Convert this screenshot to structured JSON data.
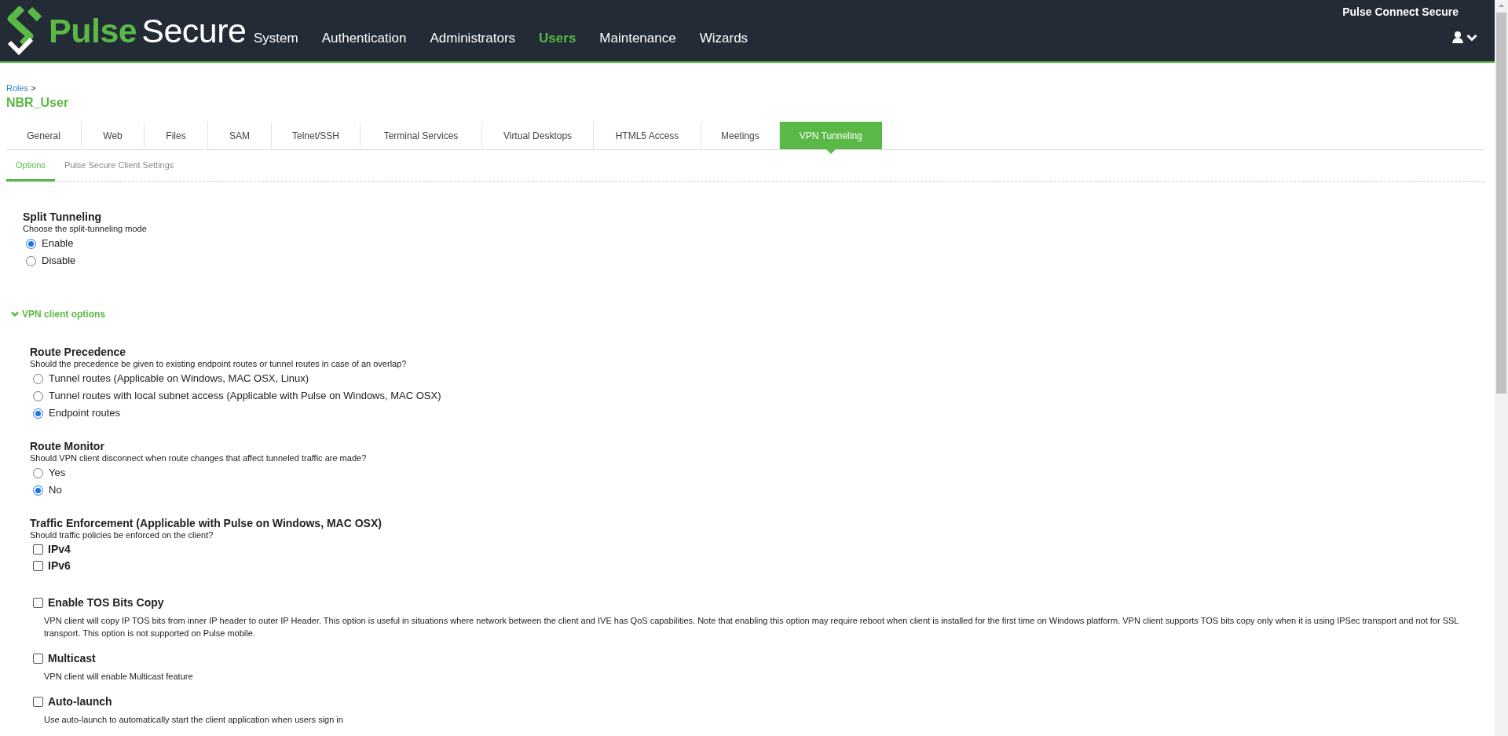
{
  "header": {
    "brand_primary": "Pulse",
    "brand_secondary": "Secure",
    "product": "Pulse Connect Secure",
    "nav": [
      {
        "label": "System",
        "selected": false
      },
      {
        "label": "Authentication",
        "selected": false
      },
      {
        "label": "Administrators",
        "selected": false
      },
      {
        "label": "Users",
        "selected": true
      },
      {
        "label": "Maintenance",
        "selected": false
      },
      {
        "label": "Wizards",
        "selected": false
      }
    ]
  },
  "breadcrumb": {
    "link": "Roles",
    "separator": ">"
  },
  "page_title": "NBR_User",
  "tabs": [
    {
      "label": "General",
      "selected": false
    },
    {
      "label": "Web",
      "selected": false
    },
    {
      "label": "Files",
      "selected": false
    },
    {
      "label": "SAM",
      "selected": false
    },
    {
      "label": "Telnet/SSH",
      "selected": false
    },
    {
      "label": "Terminal Services",
      "selected": false
    },
    {
      "label": "Virtual Desktops",
      "selected": false
    },
    {
      "label": "HTML5 Access",
      "selected": false
    },
    {
      "label": "Meetings",
      "selected": false
    },
    {
      "label": "VPN Tunneling",
      "selected": true
    }
  ],
  "subtabs": [
    {
      "label": "Options",
      "selected": true
    },
    {
      "label": "Pulse Secure Client Settings",
      "selected": false
    }
  ],
  "split_tunneling": {
    "title": "Split Tunneling",
    "description": "Choose the split-tunneling mode",
    "options": [
      {
        "label": "Enable",
        "selected": true
      },
      {
        "label": "Disable",
        "selected": false
      }
    ]
  },
  "vpn_client_options": {
    "label": "VPN client options",
    "expanded": true,
    "sections": [
      {
        "kind": "radio",
        "title": "Route Precedence",
        "description": "Should the precedence be given to existing endpoint routes or tunnel routes in case of an overlap?",
        "options": [
          {
            "label": "Tunnel routes (Applicable on Windows, MAC OSX, Linux)",
            "selected": false
          },
          {
            "label": "Tunnel routes with local subnet access (Applicable with Pulse on Windows, MAC OSX)",
            "selected": false
          },
          {
            "label": "Endpoint routes",
            "selected": true
          }
        ]
      },
      {
        "kind": "radio",
        "title": "Route Monitor",
        "description": "Should VPN client disconnect when route changes that affect tunneled traffic are made?",
        "options": [
          {
            "label": "Yes",
            "selected": false
          },
          {
            "label": "No",
            "selected": true
          }
        ]
      },
      {
        "kind": "checkbox_group",
        "title": "Traffic Enforcement (Applicable with Pulse on Windows, MAC OSX)",
        "description": "Should traffic policies be enforced on the client?",
        "items": [
          {
            "label": "IPv4",
            "checked": false
          },
          {
            "label": "IPv6",
            "checked": false
          }
        ]
      },
      {
        "kind": "checkbox",
        "label": "Enable TOS Bits Copy",
        "checked": false,
        "description": "VPN client will copy IP TOS bits from inner IP header to outer IP Header. This option is useful in situations where network between the client and IVE has QoS capabilities. Note that enabling this option may require reboot when client is installed for the first time on Windows platform. VPN client supports TOS bits copy only when it is using IPSec transport and not for SSL transport. This option is not supported on Pulse mobile."
      },
      {
        "kind": "checkbox",
        "label": "Multicast",
        "checked": false,
        "description": "VPN client will enable Multicast feature"
      },
      {
        "kind": "checkbox",
        "label": "Auto-launch",
        "checked": false,
        "description": "Use auto-launch to automatically start the client application when users sign in"
      }
    ]
  }
}
